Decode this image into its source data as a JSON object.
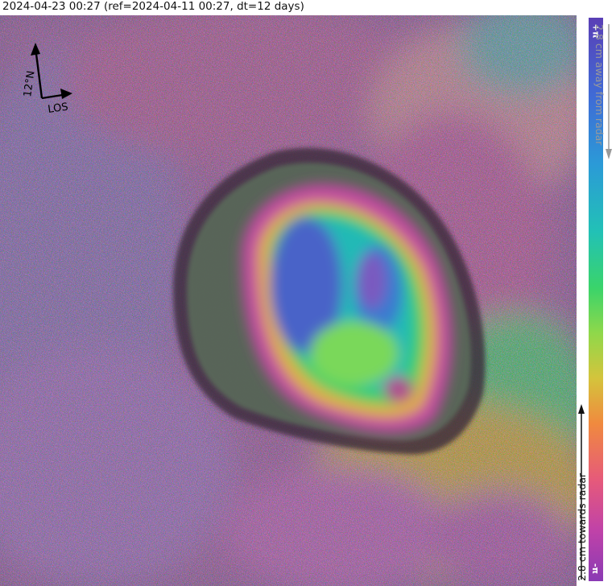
{
  "title": "2024-04-23 00:27 (ref=2024-04-11 00:27, dt=12 days)",
  "compass": {
    "north_label": "12°N",
    "los_label": "LOS"
  },
  "colorbar": {
    "top_label": "+π",
    "bottom_label": "-π",
    "away_label": "2.8 cm away from radar",
    "towards_label": "2.8 cm towards radar"
  }
}
